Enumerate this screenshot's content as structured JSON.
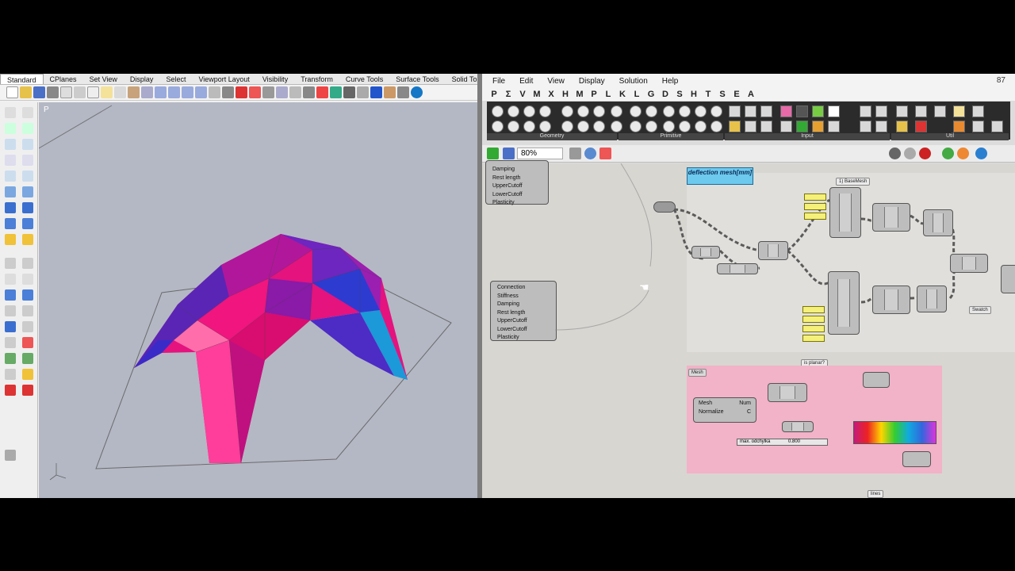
{
  "rhino": {
    "tabs": [
      "Standard",
      "CPlanes",
      "Set View",
      "Display",
      "Select",
      "Viewport Layout",
      "Visibility",
      "Transform",
      "Curve Tools",
      "Surface Tools",
      "Solid To"
    ],
    "viewport_label": "P"
  },
  "grasshopper": {
    "menu": [
      "File",
      "Edit",
      "View",
      "Display",
      "Solution",
      "Help"
    ],
    "letters": [
      "P",
      "Σ",
      "V",
      "M",
      "X",
      "H",
      "M",
      "P",
      "L",
      "K",
      "L",
      "G",
      "D",
      "S",
      "H",
      "T",
      "S",
      "E",
      "A"
    ],
    "zoom_indicator": "87",
    "ribbon_groups": [
      "Geometry",
      "Primitive",
      "Input",
      "Util"
    ],
    "zoom": "80%",
    "nodes": {
      "deflection_title": "deflection mesh[mm]",
      "base_mesh": "1) BaseMesh",
      "is_planar": "is planar?",
      "mesh_label": "Mesh",
      "max_label": "max. odchylka",
      "slider_value": "0.800",
      "swatch": "Swatch",
      "lines": "lines",
      "upper_params": [
        "Damping",
        "Rest length",
        "UpperCutoff",
        "LowerCutoff",
        "Plasticity"
      ],
      "lower_params": [
        "Connection",
        "Stiffness",
        "Damping",
        "Rest length",
        "UpperCutoff",
        "LowerCutoff",
        "Plasticity"
      ],
      "mesh_params": [
        "Mesh",
        "Normalize"
      ],
      "mesh_outputs": [
        "Num",
        "C"
      ]
    }
  }
}
